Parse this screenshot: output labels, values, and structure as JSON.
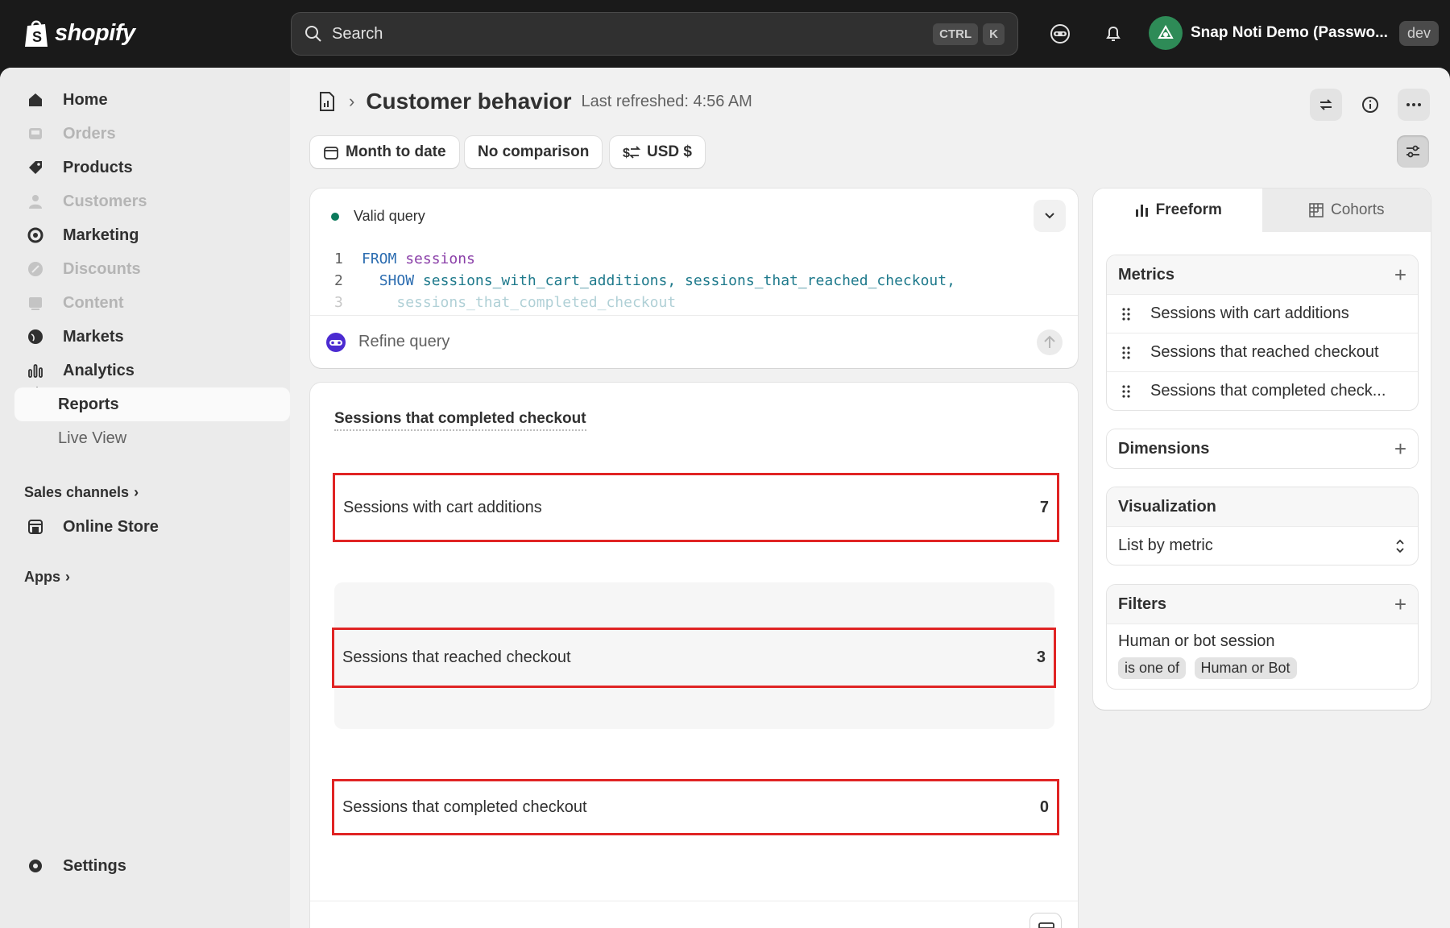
{
  "topbar": {
    "logo_text": "shopify",
    "search_placeholder": "Search",
    "shortcut_ctrl": "CTRL",
    "shortcut_k": "K",
    "store_name": "Snap Noti Demo (Passwo...",
    "store_badge": "dev"
  },
  "sidebar": {
    "items": [
      {
        "label": "Home",
        "icon": "home-icon"
      },
      {
        "label": "Orders",
        "icon": "inbox-icon"
      },
      {
        "label": "Products",
        "icon": "tag-icon"
      },
      {
        "label": "Customers",
        "icon": "person-icon"
      },
      {
        "label": "Marketing",
        "icon": "target-icon"
      },
      {
        "label": "Discounts",
        "icon": "discount-icon"
      },
      {
        "label": "Content",
        "icon": "image-icon"
      },
      {
        "label": "Markets",
        "icon": "globe-icon"
      },
      {
        "label": "Analytics",
        "icon": "bar-chart-icon"
      },
      {
        "label": "Reports"
      },
      {
        "label": "Live View"
      }
    ],
    "sales_channels": "Sales channels",
    "online_store": "Online Store",
    "apps": "Apps",
    "settings": "Settings"
  },
  "header": {
    "title": "Customer behavior",
    "last_refreshed": "Last refreshed: 4:56 AM"
  },
  "filters": {
    "date": "Month to date",
    "comparison": "No comparison",
    "currency": "USD $"
  },
  "query": {
    "status": "Valid query",
    "lines": [
      {
        "num": "1",
        "kw": "FROM",
        "rest": "sessions"
      },
      {
        "num": "2",
        "kw": "SHOW",
        "rest": "sessions_with_cart_additions, sessions_that_reached_checkout,"
      },
      {
        "num": "3",
        "kw": "",
        "rest": "sessions_that_completed_checkout"
      }
    ],
    "refine_placeholder": "Refine query"
  },
  "result": {
    "title": "Sessions that completed checkout",
    "rows": [
      {
        "label": "Sessions with cart additions",
        "value": "7"
      },
      {
        "label": "Sessions that reached checkout",
        "value": "3"
      },
      {
        "label": "Sessions that completed checkout",
        "value": "0"
      }
    ]
  },
  "panel": {
    "tab_freeform": "Freeform",
    "tab_cohorts": "Cohorts",
    "metrics_title": "Metrics",
    "metrics": [
      "Sessions with cart additions",
      "Sessions that reached checkout",
      "Sessions that completed check..."
    ],
    "dimensions_title": "Dimensions",
    "visualization_title": "Visualization",
    "visualization_value": "List by metric",
    "filters_title": "Filters",
    "filter_field": "Human or bot session",
    "filter_op": "is one of",
    "filter_value": "Human or Bot"
  },
  "colors": {
    "accent_red": "#e02424",
    "valid_green": "#0b7a5b"
  }
}
